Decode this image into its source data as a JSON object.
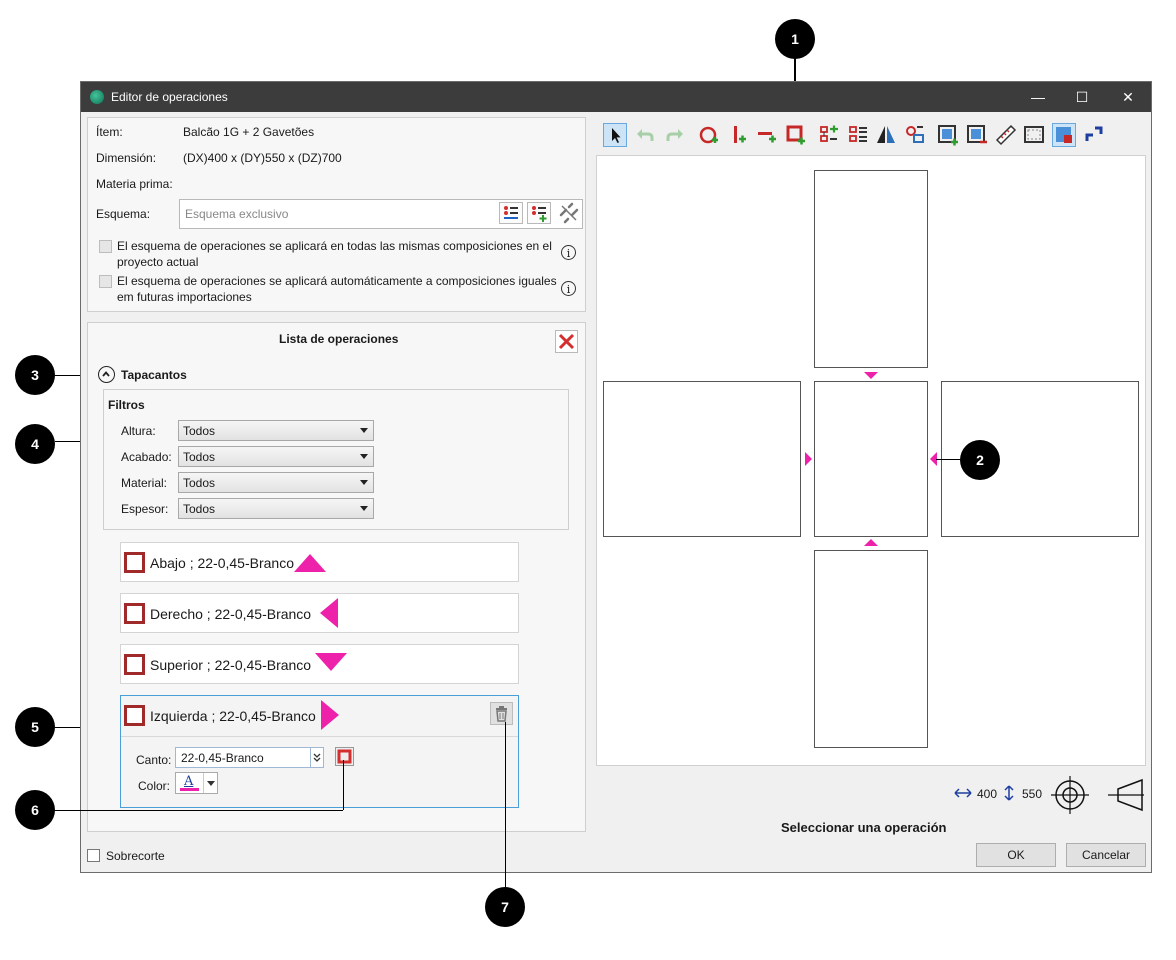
{
  "window": {
    "title": "Editor de operaciones",
    "minimize": "—",
    "maximize": "☐",
    "close": "✕"
  },
  "info": {
    "item_label": "Ítem:",
    "item_value": "Balcão 1G + 2 Gavetões",
    "dim_label": "Dimensión:",
    "dim_value": "(DX)400 x (DY)550 x (DZ)700",
    "material_label": "Materia prima:",
    "schema_label": "Esquema:",
    "schema_placeholder": "Esquema exclusivo",
    "check1_line1": "El esquema de operaciones se aplicará en todas las mismas composiciones en el",
    "check1_line2": "proyecto actual",
    "check2_line1": "El esquema de operaciones se aplicará automáticamente a composiciones iguales",
    "check2_line2": "em futuras importaciones",
    "info_glyph": "i"
  },
  "operations": {
    "title": "Lista de operaciones",
    "section": "Tapacantos",
    "filters_title": "Filtros",
    "filters": [
      {
        "label": "Altura:",
        "value": "Todos"
      },
      {
        "label": "Acabado:",
        "value": "Todos"
      },
      {
        "label": "Material:",
        "value": "Todos"
      },
      {
        "label": "Espesor:",
        "value": "Todos"
      }
    ],
    "items": [
      {
        "label": "Abajo ; 22-0,45-Branco"
      },
      {
        "label": "Derecho ; 22-0,45-Branco"
      },
      {
        "label": "Superior ; 22-0,45-Branco"
      },
      {
        "label": "Izquierda ; 22-0,45-Branco"
      }
    ],
    "detail": {
      "canto_label": "Canto:",
      "canto_value": "22-0,45-Branco",
      "color_label": "Color:",
      "color_glyph": "A"
    }
  },
  "footer": {
    "oversize_label": "Sobrecorte",
    "width_value": "400",
    "height_value": "550",
    "status": "Seleccionar una operación",
    "ok": "OK",
    "cancel": "Cancelar"
  },
  "callouts": [
    "1",
    "2",
    "3",
    "4",
    "5",
    "6",
    "7"
  ],
  "colors": {
    "accent": "#ee22aa",
    "edge_check": "#a0292a",
    "titlebar": "#3c3c3c",
    "delete": "#d32f2f"
  },
  "icons": [
    "arrow-pointer-icon",
    "undo-icon",
    "redo-icon",
    "add-circle-icon",
    "add-vertical-icon",
    "add-horizontal-icon",
    "add-rect-icon",
    "add-list-icon",
    "list-numbered-icon",
    "mirror-icon",
    "replace-icon",
    "add-panel-icon",
    "remove-panel-icon",
    "ruler-icon",
    "frame-icon",
    "select-panel-icon",
    "rotate-icon"
  ]
}
